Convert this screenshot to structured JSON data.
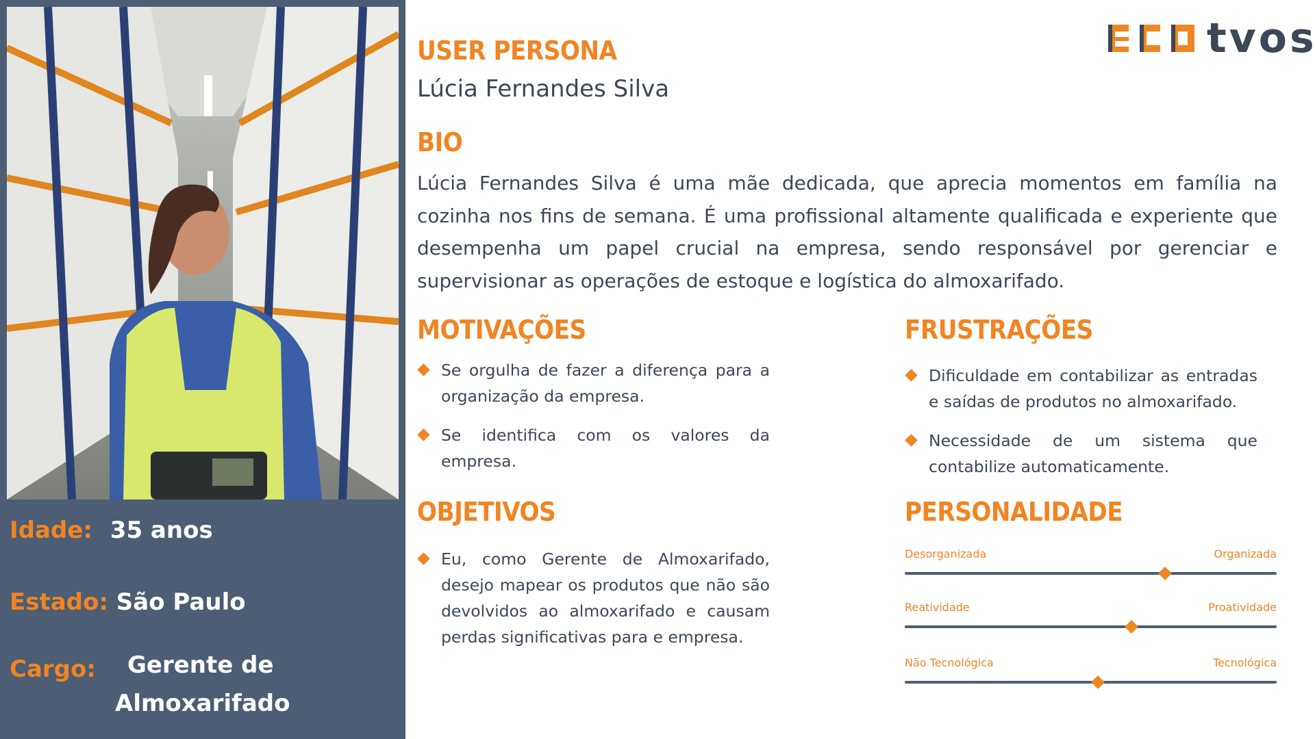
{
  "logo": {
    "text_suffix": "tvos",
    "icon": "eco-blocks-logo-icon",
    "accent_color": "#f08522"
  },
  "persona": {
    "title": "USER PERSONA",
    "name": "Lúcia Fernandes Silva"
  },
  "bio": {
    "heading": "BIO",
    "text": "Lúcia Fernandes Silva é uma mãe dedicada, que aprecia momentos em família na cozinha nos fins de semana. É uma profissional altamente qualificada e experiente que desempenha um papel crucial na empresa, sendo responsável por gerenciar e supervisionar as operações de estoque e logística do almoxarifado."
  },
  "profile": {
    "photo_icon": "warehouse-worker-photo",
    "age_label": "Idade:",
    "age_value": "35 anos",
    "state_label": "Estado:",
    "state_value": "São Paulo",
    "role_label": "Cargo:",
    "role_value_line1": "Gerente de",
    "role_value_line2": "Almoxarifado"
  },
  "motivations": {
    "heading": "MOTIVAÇÕES",
    "items": [
      "Se orgulha de fazer a diferença para a organização da empresa.",
      "Se identifica com os valores da empresa."
    ]
  },
  "frustrations": {
    "heading": "FRUSTRAÇÕES",
    "items": [
      "Dificuldade em  contabilizar as entradas e saídas de produtos no almoxarifado.",
      "Necessidade de um sistema que contabilize automaticamente."
    ]
  },
  "objectives": {
    "heading": "OBJETIVOS",
    "items": [
      "Eu, como Gerente de Almoxarifado, desejo mapear os produtos que não são devolvidos ao almoxarifado e causam perdas significativas para e empresa."
    ]
  },
  "personality": {
    "heading": "PERSONALIDADE",
    "scales": [
      {
        "left": "Desorganizada",
        "right": "Organizada",
        "value": 0.7
      },
      {
        "left": "Reatividade",
        "right": "Proatividade",
        "value": 0.61
      },
      {
        "left": "Não Tecnológica",
        "right": "Tecnológica",
        "value": 0.52
      }
    ]
  },
  "colors": {
    "accent": "#f08522",
    "slate": "#4c5d74",
    "text": "#3d4756"
  }
}
